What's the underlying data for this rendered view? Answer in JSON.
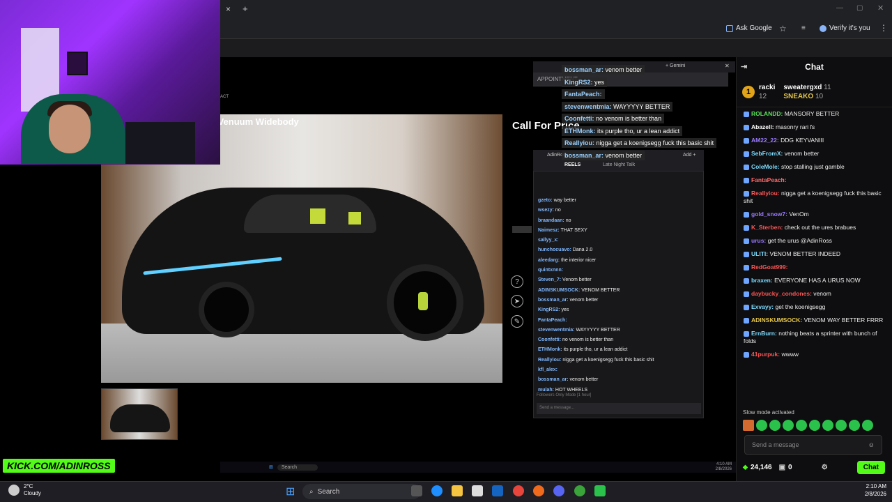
{
  "browser": {
    "new_tab": "+",
    "close_tab": "×",
    "ask_google": "Ask Google",
    "verify": "Verify it's you"
  },
  "page": {
    "headline": "ungue Venuum Widebody",
    "call_price": "Call For Price",
    "contact": "ACT",
    "appointment": "APPOINTMENT"
  },
  "popup": {
    "gemini": "+ Gemini",
    "tab_title": "AdinRoss",
    "tab_title2": "Late Night Talk",
    "reels": "REELS",
    "add": "Add +"
  },
  "overlay_messages": [
    {
      "user": "bossman_ar:",
      "text": "venom better"
    },
    {
      "user": "KingRS2:",
      "text": "yes"
    },
    {
      "user": "FantaPeach:",
      "text": ""
    },
    {
      "user": "stevenwentmia:",
      "text": "WAYYYYY BETTER"
    },
    {
      "user": "Coonfetti:",
      "text": "no venom is better than"
    },
    {
      "user": "ETHMonk:",
      "text": "its purple tho, ur a lean addict"
    },
    {
      "user": "Reallyiou:",
      "text": "nigga get a koenigsegg fuck this basic shit"
    },
    {
      "user": "bossman_ar:",
      "text": "venom better"
    }
  ],
  "inner_chat": [
    {
      "user": "gzeto:",
      "text": "way better"
    },
    {
      "user": "wsezy:",
      "text": "no"
    },
    {
      "user": "braandaan:",
      "text": "no"
    },
    {
      "user": "Naimesz:",
      "text": "THAT SEXY"
    },
    {
      "user": "sallyy_x:",
      "text": ""
    },
    {
      "user": "hunchocuavo:",
      "text": "Dana 2.0"
    },
    {
      "user": "aleedarg:",
      "text": "the interior nicer"
    },
    {
      "user": "quintxnnn:",
      "text": ""
    },
    {
      "user": "Steven_7:",
      "text": "Venom better"
    },
    {
      "user": "ADINSKUMSOCK:",
      "text": "VENOM BETTER"
    },
    {
      "user": "bossman_ar:",
      "text": "venom better"
    },
    {
      "user": "KingRS2:",
      "text": "yes"
    },
    {
      "user": "FantaPeach:",
      "text": ""
    },
    {
      "user": "stevenwentmia:",
      "text": "WAYYYYY BETTER"
    },
    {
      "user": "Coonfetti:",
      "text": "no venom is better than"
    },
    {
      "user": "ETHMonk:",
      "text": "its purple tho, ur a lean addict"
    },
    {
      "user": "Reallyiou:",
      "text": "nigga get a koenigsegg fuck this basic shit"
    },
    {
      "user": "kfl_alex:",
      "text": ""
    },
    {
      "user": "bossman_ar:",
      "text": "venom better"
    },
    {
      "user": "mulah:",
      "text": "HOT WHEELS"
    }
  ],
  "inner_chat_footer": {
    "followers_only": "Followers Only Mode [1 hour]",
    "send_placeholder": "Send a message..."
  },
  "chat": {
    "title": "Chat",
    "gifters": [
      {
        "rank": "1",
        "name": "racki",
        "count": "12"
      },
      {
        "rank": "",
        "name": "sweatergxd",
        "count": "11"
      },
      {
        "rank": "",
        "name": "SNEAKO",
        "count": "10"
      }
    ],
    "messages": [
      {
        "user": "ROLANDD:",
        "text": "MANSORY BETTER",
        "color": "#5be05b"
      },
      {
        "user": "Abazell:",
        "text": "masonry rari fs",
        "color": "#ffffff"
      },
      {
        "user": "AM22_22:",
        "text": "DDG KEYVANIII",
        "color": "#9b7bff"
      },
      {
        "user": "SebFromX:",
        "text": "venom better",
        "color": "#7ddcff"
      },
      {
        "user": "ColeMole:",
        "text": "stop stalling just gamble",
        "color": "#7ddcff"
      },
      {
        "user": "FantaPeach:",
        "text": "",
        "color": "#ff6b6b"
      },
      {
        "user": "Reallyiou:",
        "text": "nigga get a koenigsegg fuck this basic shit",
        "color": "#ff5555"
      },
      {
        "user": "gold_snow7:",
        "text": "VenOm",
        "color": "#9b7bff"
      },
      {
        "user": "K_Sterben:",
        "text": "check out the ures brabues",
        "color": "#ff5555"
      },
      {
        "user": "urus:",
        "text": "get the urus @AdinRoss",
        "color": "#9b7bff"
      },
      {
        "user": "ULITI:",
        "text": "VENOM BETTER INDEED",
        "color": "#7ddcff"
      },
      {
        "user": "RedGoat999:",
        "text": "",
        "color": "#ff5555"
      },
      {
        "user": "braxen:",
        "text": "EVERYONE HAS A URUS NOW",
        "color": "#7ddcff"
      },
      {
        "user": "daybucky_condones:",
        "text": "venom",
        "color": "#ff5555"
      },
      {
        "user": "Exvayy:",
        "text": "get the koenigsegg",
        "color": "#7ddcff"
      },
      {
        "user": "ADINSKUMSOCK:",
        "text": "VENOM WAY BETTER FRRR",
        "color": "#e8c84a"
      },
      {
        "user": "ErnBurn:",
        "text": "nothing beats a sprinter with bunch of folds",
        "color": "#7ddcff"
      },
      {
        "user": "41purpuk:",
        "text": "wwww",
        "color": "#ff5555"
      }
    ],
    "slow_mode": "Slow mode activated",
    "send_placeholder": "Send a message",
    "viewers": "24,146",
    "other_count": "0",
    "chat_button": "Chat"
  },
  "stream": {
    "logo_text": "KICK.COM/ADINROSS"
  },
  "taskbar": {
    "temperature": "2°C",
    "condition": "Cloudy",
    "search": "Search",
    "time": "2:10 AM",
    "date": "2/8/2026"
  },
  "inner_taskbar": {
    "search": "Search",
    "time": "4:10 AM",
    "date": "2/8/2026"
  },
  "colors": {
    "kick_green": "#53fc18",
    "chat_bg": "#0e0e10"
  }
}
